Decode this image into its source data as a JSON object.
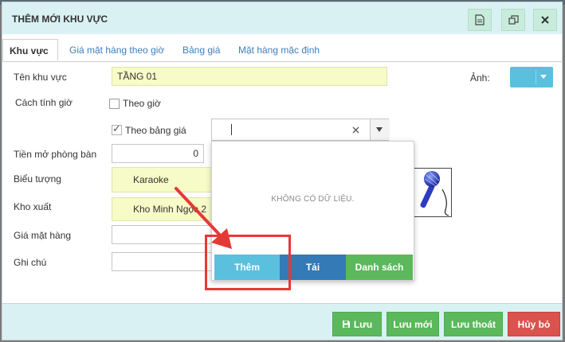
{
  "dialog": {
    "title": "THÊM MỚI KHU VỰC"
  },
  "tabs": [
    {
      "label": "Khu vực"
    },
    {
      "label": "Giá mặt hàng theo giờ"
    },
    {
      "label": "Bảng giá"
    },
    {
      "label": "Mặt hàng mặc định"
    }
  ],
  "form": {
    "ten_khu_vuc": {
      "label": "Tên khu vực",
      "value": "TẦNG 01"
    },
    "anh": {
      "label": "Ảnh:"
    },
    "cach_tinh_gio": {
      "label": "Cách tính giờ",
      "theo_gio": "Theo giờ",
      "theo_bang_gia": "Theo bảng giá",
      "theo_bang_gia_check": "✓"
    },
    "tien_mo_phong_ban": {
      "label": "Tiền mở phòng bàn",
      "value": "0"
    },
    "bieu_tuong": {
      "label": "Biểu tượng",
      "value": "Karaoke"
    },
    "kho_xuat": {
      "label": "Kho xuất",
      "value": "Kho Minh Ngọc 2"
    },
    "gia_mat_hang": {
      "label": "Giá mặt hàng",
      "value": ""
    },
    "ghi_chu": {
      "label": "Ghi chú",
      "value": ""
    }
  },
  "dropdown": {
    "empty_text": "KHÔNG CÓ DỮ LIỆU.",
    "buttons": {
      "them": "Thêm",
      "tai": "Tải",
      "danh_sach": "Danh sách"
    }
  },
  "footer": {
    "luu": "Lưu",
    "luu_moi": "Lưu mới",
    "luu_thoat": "Lưu thoát",
    "huy_bo": "Hủy bỏ"
  },
  "colors": {
    "header_bg": "#d9f1f3",
    "input_yellow": "#f6fbc7",
    "btn_green": "#5cb85c",
    "btn_blue": "#337ab7",
    "btn_lightblue": "#5bc0de",
    "btn_red": "#d9534f",
    "annotation_red": "#e53935"
  }
}
